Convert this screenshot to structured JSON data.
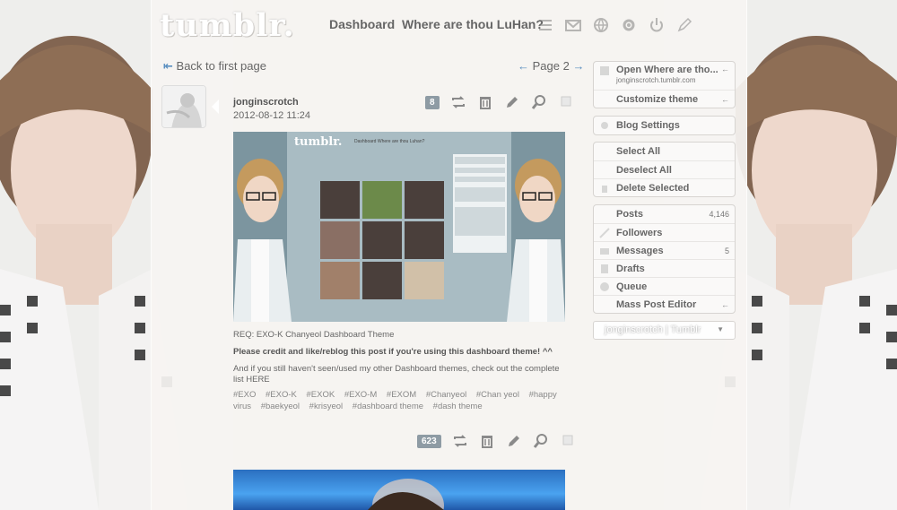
{
  "header": {
    "logo": "tumblr.",
    "nav_dashboard": "Dashboard",
    "nav_blog": "Where are thou LuHan?",
    "icons": [
      "list-icon",
      "mail-icon",
      "globe-icon",
      "gear-icon",
      "power-icon",
      "pencil-icon"
    ]
  },
  "pager": {
    "back_arrow": "⇤",
    "back_label": "Back to first page",
    "prev_arrow": "←",
    "page_label": "Page 2",
    "next_arrow": "→"
  },
  "post": {
    "username": "jonginscrotch",
    "date": "2012-08-12 11:24",
    "note_count": "8",
    "caption_req": "REQ: EXO-K Chanyeol Dashboard Theme",
    "caption_bold": "Please credit and like/reblog this post if you're using this dashboard theme! ^^",
    "caption_more": "And if you still haven't seen/used my other Dashboard themes, check out the complete list HERE",
    "tags": [
      "#EXO",
      "#EXO-K",
      "#EXOK",
      "#EXO-M",
      "#EXOM",
      "#Chanyeol",
      "#Chan yeol",
      "#happy virus",
      "#baekyeol",
      "#krisyeol",
      "#dashboard theme",
      "#dash theme"
    ]
  },
  "post2": {
    "note_count": "623"
  },
  "sidebar": {
    "blog_title": "Open Where are tho...",
    "blog_url": "jonginscrotch.tumblr.com",
    "customize": "Customize theme",
    "settings": "Blog Settings",
    "select_all": "Select All",
    "deselect_all": "Deselect All",
    "delete_selected": "Delete Selected",
    "posts": "Posts",
    "posts_count": "4,146",
    "followers": "Followers",
    "messages": "Messages",
    "messages_count": "5",
    "drafts": "Drafts",
    "queue": "Queue",
    "mass_editor": "Mass Post Editor",
    "arrow": "←",
    "search_placeholder": "jonginscrotch | Tumblr",
    "dropdown_glyph": "▼"
  },
  "colors": {
    "accent": "#5a8fc0",
    "badge": "#8e9ba4",
    "panel": "#f6f4f2"
  }
}
